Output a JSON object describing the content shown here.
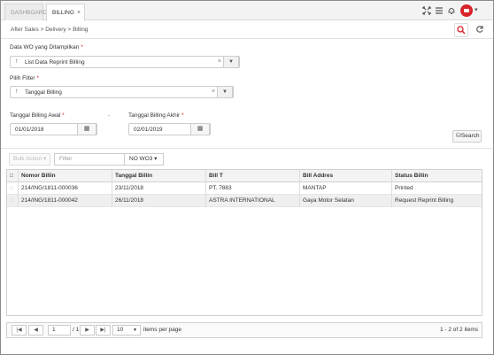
{
  "tabs": [
    {
      "label": "DASHBOARD"
    },
    {
      "label": "BILLING",
      "close": "×"
    }
  ],
  "toolbar_icons": [
    "expand-icon",
    "menu-icon",
    "bell-icon",
    "user-avatar",
    "chevron-down-icon"
  ],
  "breadcrumb": "After Sales > Delivery > Billing",
  "form": {
    "data_wo_label": "Data WO yang Ditampilkan",
    "data_wo_value": "List Data Reprint Billing",
    "pilih_filter_label": "Pilih Filter",
    "pilih_filter_value": "Tanggal Billing",
    "tgl_awal_label": "Tanggal Billing Awal",
    "tgl_awal_value": "01/01/2018",
    "separator": "-",
    "tgl_akhir_label": "Tanggal Billing Akhir",
    "tgl_akhir_value": "02/01/2019",
    "required_mark": "*",
    "search_label": "Search"
  },
  "grid_toolbar": {
    "bulk_action": "Bulk Action",
    "filter_placeholder": "Filter",
    "wo_filter": "NO WO3"
  },
  "table": {
    "columns": [
      "Nomor Billin",
      "Tanggal Billin",
      "Bill T",
      "Bill Addres",
      "Status Billin"
    ],
    "rows": [
      [
        "214/ING/1811-000036",
        "23/11/2018",
        "PT. 7883",
        "MANTAP",
        "Printed"
      ],
      [
        "214/ING/1811-000042",
        "26/11/2018",
        "ASTRA INTERNATIONAL",
        "Gaya Motor Selatan",
        "Request Reprint Billing"
      ]
    ]
  },
  "pager": {
    "page": "1",
    "of": "/ 1",
    "page_size": "10",
    "per_page_label": "items per page",
    "info": "1 - 2 of 2 items"
  },
  "colors": {
    "accent": "#d8232a"
  }
}
